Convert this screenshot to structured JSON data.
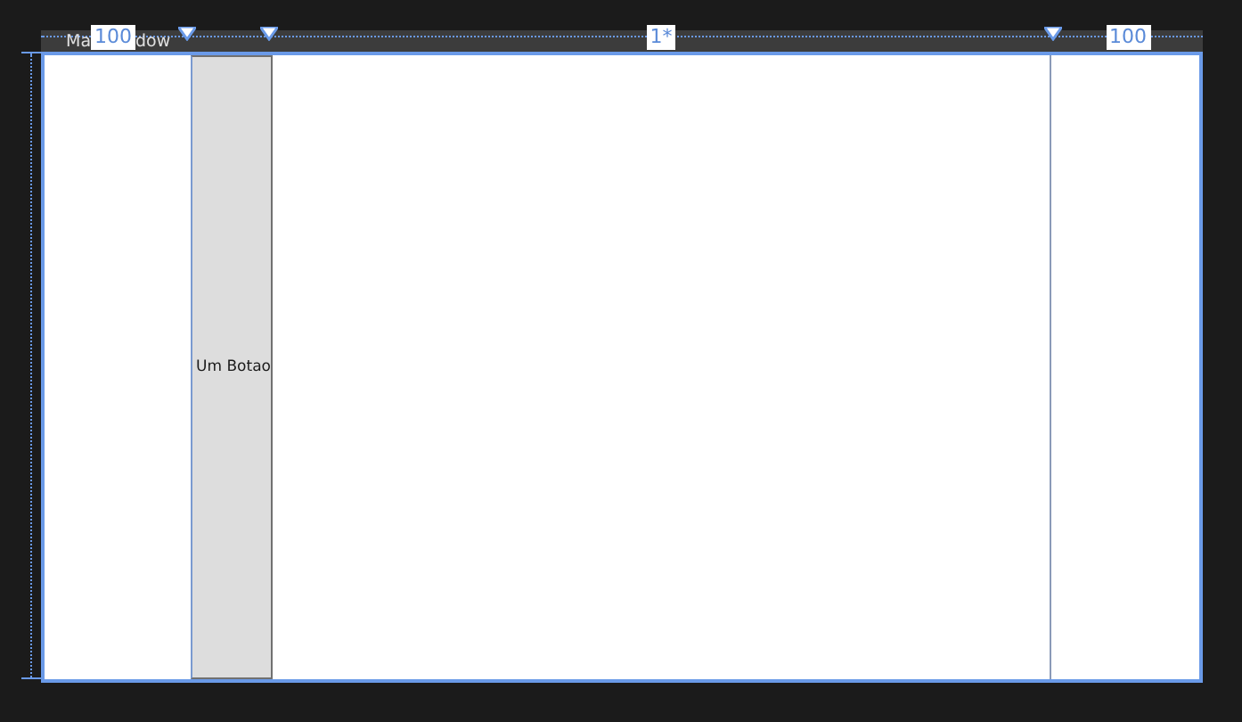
{
  "window": {
    "title_parts": [
      "Ma",
      "dow"
    ]
  },
  "columns": [
    {
      "label": "100"
    },
    {},
    {
      "label": "1*"
    },
    {
      "label": "100"
    }
  ],
  "button": {
    "label": "Um Botao"
  }
}
